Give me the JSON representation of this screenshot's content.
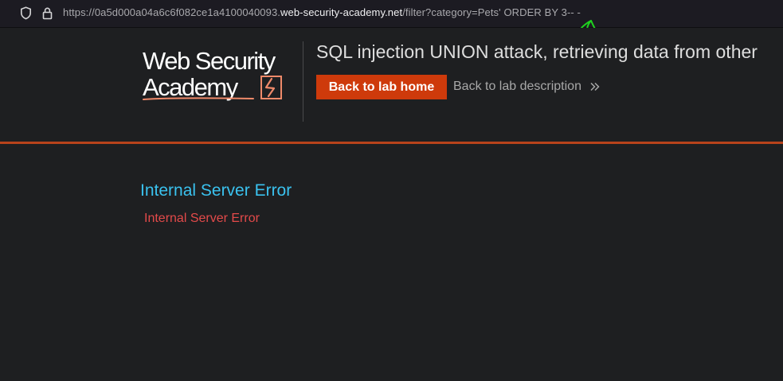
{
  "browser": {
    "url_prefix": "https://0a5d000a04a6c6f082ce1a4100040093.",
    "url_host": "web-security-academy.net",
    "url_path": "/filter?category=Pets' ORDER BY 3-- -"
  },
  "header": {
    "logo_line1": "Web Security",
    "logo_line2": "Academy",
    "lab_title": "SQL injection UNION attack, retrieving data from other",
    "back_home_label": "Back to lab home",
    "back_description_label": "Back to lab description"
  },
  "content": {
    "error_heading": "Internal Server Error",
    "error_message": "Internal Server Error"
  },
  "colors": {
    "accent": "#ce3a0b",
    "heading": "#3ac2ef",
    "error": "#e34a4a",
    "annotation": "#1fd11f"
  }
}
